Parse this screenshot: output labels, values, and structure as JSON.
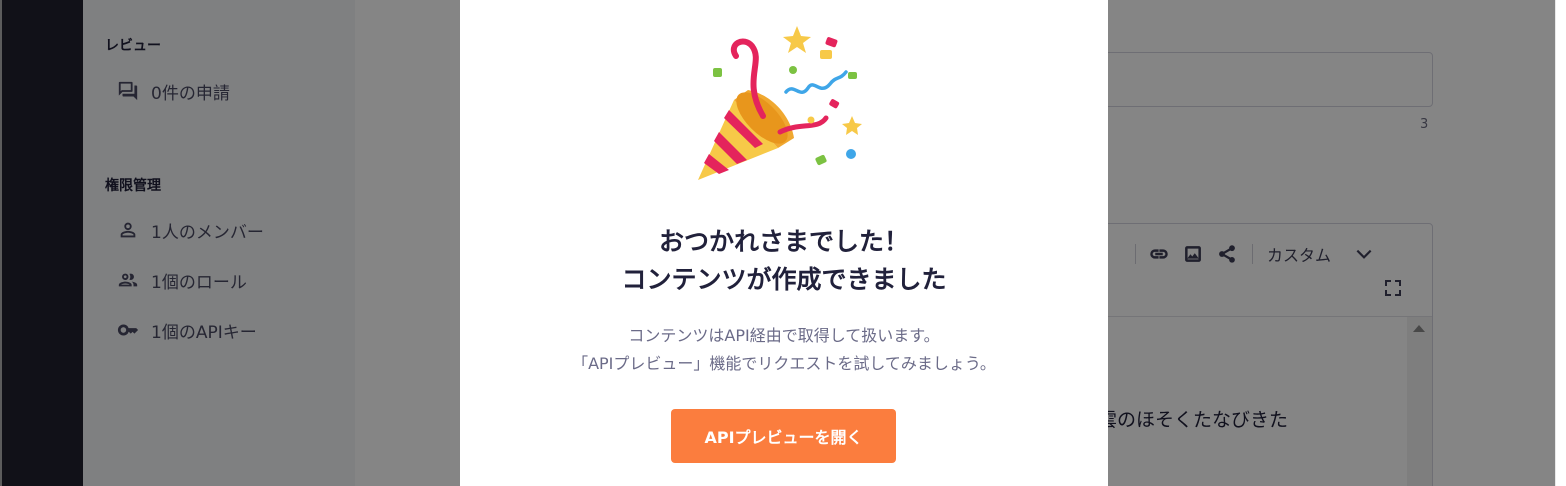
{
  "sidebar": {
    "review": {
      "title": "レビュー",
      "items": [
        {
          "label": "0件の申請",
          "icon": "comments-icon"
        }
      ]
    },
    "permissions": {
      "title": "権限管理",
      "items": [
        {
          "label": "1人のメンバー",
          "icon": "person-icon"
        },
        {
          "label": "1個のロール",
          "icon": "people-icon"
        },
        {
          "label": "1個のAPIキー",
          "icon": "key-icon"
        }
      ]
    }
  },
  "main": {
    "field_counter": "3",
    "editor": {
      "toolbar": {
        "icons": [
          "list-icon",
          "link-icon",
          "image-icon",
          "share-icon"
        ],
        "custom_label": "カスタム",
        "dropdown_icon": "chevron-down-icon",
        "expand_icon": "expand-icon"
      },
      "text": "雲のほそくたなびきた"
    }
  },
  "modal": {
    "illustration": "party-popper-icon",
    "title_line1": "おつかれさまでした！",
    "title_line2": "コンテンツが作成できました",
    "desc_line1": "コンテンツはAPI経由で取得して扱います。",
    "desc_line2": "「APIプレビュー」機能でリクエストを試してみましょう。",
    "cta_label": "APIプレビューを開く"
  },
  "colors": {
    "accent": "#fb7d3e",
    "nav_rail": "#21212f",
    "heading": "#21213b",
    "overlay": "rgba(0,0,0,0.48)"
  }
}
